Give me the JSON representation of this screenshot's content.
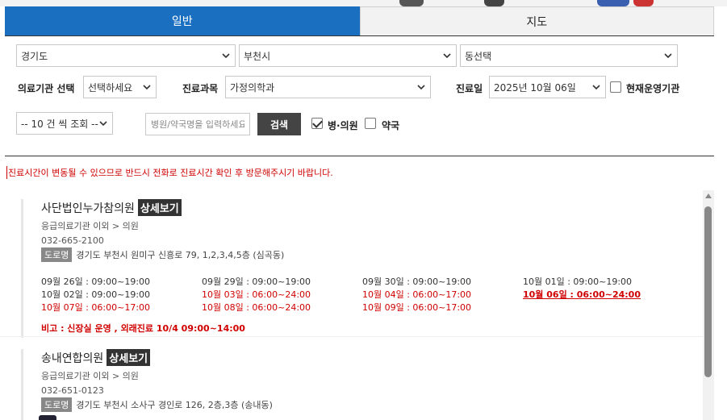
{
  "tabs": [
    {
      "label": "일반",
      "active": true
    },
    {
      "label": "지도",
      "active": false
    }
  ],
  "filters": {
    "province": "경기도",
    "city": "부천시",
    "dong": "동선택",
    "institution_type_label": "의료기관 선택",
    "institution_type_value": "선택하세요",
    "department_label": "진료과목",
    "department_value": "가정의학과",
    "date_label": "진료일",
    "date_value": "2025년 10월 06일",
    "open_now_label": "현재운영기관",
    "open_now_checked": false,
    "page_size": "-- 10 건 씩 조회 --",
    "search_placeholder": "병원/약국명을 입력하세요",
    "search_button": "검색",
    "hospital_label": "병·의원",
    "hospital_checked": true,
    "pharmacy_label": "약국",
    "pharmacy_checked": false
  },
  "notice": "진료시간이 변동될 수 있으므로 반드시 전화로 진료시간 확인 후 방문해주시기 바랍니다.",
  "results": [
    {
      "name": "사단법인누가참의원",
      "detail_label": "상세보기",
      "category": "응급의료기관 이외 > 의원",
      "phone": "032-665-2100",
      "road_label": "도로명",
      "address": "경기도 부천시 원미구 신흥로 79, 1,2,3,4,5층 (심곡동)",
      "schedule": [
        {
          "text": "09월 26일 : 09:00~19:00",
          "style": "normal"
        },
        {
          "text": "09월 29일 : 09:00~19:00",
          "style": "normal"
        },
        {
          "text": "09월 30일 : 09:00~19:00",
          "style": "normal"
        },
        {
          "text": "10월 01일 : 09:00~19:00",
          "style": "normal"
        },
        {
          "text": "10월 02일 : 09:00~19:00",
          "style": "normal"
        },
        {
          "text": "10월 03일 : 06:00~24:00",
          "style": "red"
        },
        {
          "text": "10월 04일 : 06:00~17:00",
          "style": "red"
        },
        {
          "text": "10월 06일 : 06:00~24:00",
          "style": "today"
        },
        {
          "text": "10월 07일 : 06:00~17:00",
          "style": "red"
        },
        {
          "text": "10월 08일 : 06:00~24:00",
          "style": "red"
        },
        {
          "text": "10월 09일 : 06:00~17:00",
          "style": "red"
        }
      ],
      "remark": "비고 : 신장실 운영 , 외래진료 10/4 09:00~14:00"
    },
    {
      "name": "송내연합의원",
      "detail_label": "상세보기",
      "category": "응급의료기관 이외 > 의원",
      "phone": "032-651-0123",
      "road_label": "도로명",
      "address": "경기도 부천시 소사구 경인로 126, 2층,3층 (송내동)"
    }
  ],
  "colors": {
    "tab_active": "#1a6fc1",
    "warning_red": "#d00000",
    "dark_button": "#444444"
  }
}
